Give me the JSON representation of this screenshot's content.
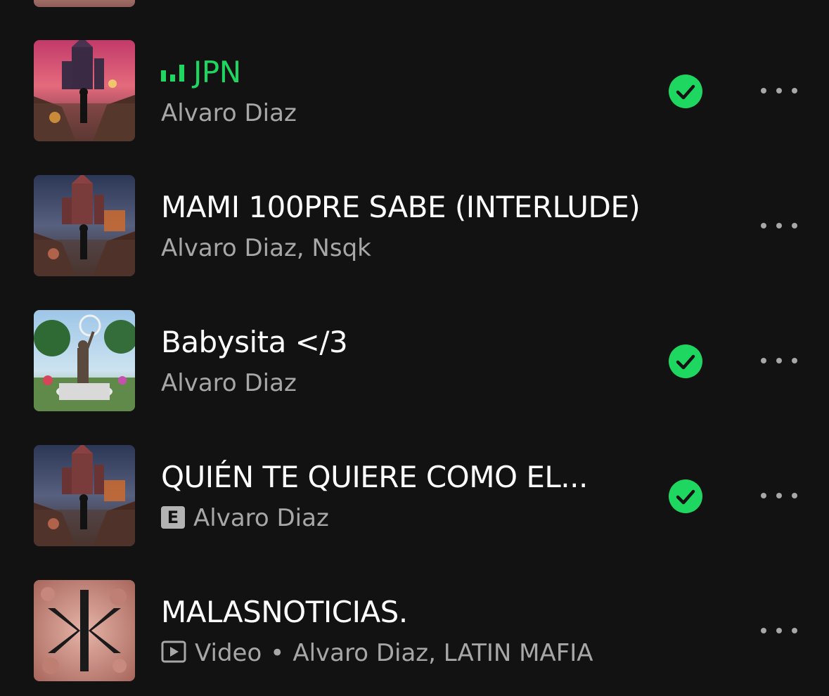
{
  "accent_color": "#1ed760",
  "tracks": [
    {
      "title": "JPN",
      "artists": "Alvaro Diaz",
      "now_playing": true,
      "downloaded": true,
      "explicit": false,
      "video": false,
      "more_label": "•••"
    },
    {
      "title": "MAMI 100PRE SABE (INTERLUDE)",
      "artists": "Alvaro Diaz, Nsqk",
      "now_playing": false,
      "downloaded": false,
      "explicit": false,
      "video": false,
      "more_label": "•••"
    },
    {
      "title": "Babysita </3",
      "artists": "Alvaro Diaz",
      "now_playing": false,
      "downloaded": true,
      "explicit": false,
      "video": false,
      "more_label": "•••"
    },
    {
      "title": "QUIÉN TE QUIERE COMO EL...",
      "artists": "Alvaro Diaz",
      "explicit_label": "E",
      "now_playing": false,
      "downloaded": true,
      "explicit": true,
      "video": false,
      "more_label": "•••"
    },
    {
      "title": "MALASNOTICIAS.",
      "artists": "Alvaro Diaz, LATIN MAFIA",
      "type_label": "Video",
      "separator": "•",
      "now_playing": false,
      "downloaded": false,
      "explicit": false,
      "video": true,
      "more_label": "•••"
    }
  ]
}
